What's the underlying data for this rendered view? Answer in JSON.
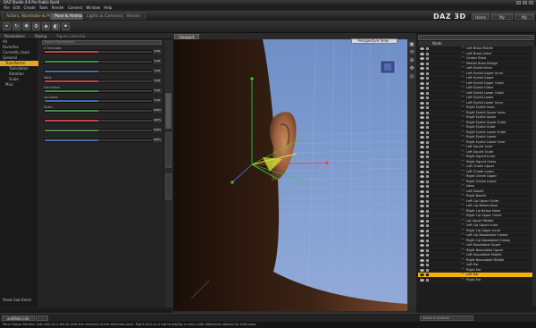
{
  "window": {
    "title": "DAZ Studio 4.6 Pro Public Build"
  },
  "menu": [
    "File",
    "Edit",
    "Create",
    "Tools",
    "Render",
    "Connect",
    "Window",
    "Help"
  ],
  "tabs": [
    "Actors, Wardrobe & Props",
    "Pose & Animate",
    "Lights & Cameras",
    "Render"
  ],
  "active_tab_index": 1,
  "brand": {
    "logo": "DAZ 3D"
  },
  "header_buttons": [
    "Home",
    "My Account",
    "My Gallery"
  ],
  "toolbar_icons": [
    "pointer-icon",
    "rotate-icon",
    "universal-tool-icon",
    "joint-editor-icon",
    "node-weight-icon",
    "surface-icon",
    "render-icon"
  ],
  "left_panel": {
    "tabs": [
      "Parameters",
      "Posing"
    ],
    "filter_label": "Figure: Lone Ear",
    "categories": [
      {
        "label": "All",
        "level": 0,
        "selected": false
      },
      {
        "label": "Favorites",
        "level": 0,
        "selected": false
      },
      {
        "label": "Currently Used",
        "level": 0,
        "selected": false
      },
      {
        "label": "General",
        "level": 0,
        "selected": false
      },
      {
        "label": "Transforms",
        "level": 1,
        "selected": true
      },
      {
        "label": "Translation",
        "level": 2,
        "selected": false
      },
      {
        "label": "Rotation",
        "level": 2,
        "selected": false
      },
      {
        "label": "Scale",
        "level": 2,
        "selected": false
      },
      {
        "label": "Misc",
        "level": 1,
        "selected": false
      }
    ],
    "show_sub_items": "Show Sub Items",
    "search_placeholder": "Search Parameters",
    "params": [
      {
        "label": "X Translate",
        "value": "0.00",
        "color": "#c04848",
        "fill": 0.5
      },
      {
        "label": "",
        "value": "0.00",
        "color": "#4a8a4a",
        "fill": 0.5
      },
      {
        "label": "",
        "value": "0.00",
        "color": "#4a6ab0",
        "fill": 0.5
      },
      {
        "label": "Twist",
        "value": "0.00",
        "color": "#c04848",
        "fill": 0.5
      },
      {
        "label": "Front-Back",
        "value": "0.00",
        "color": "#4a8a4a",
        "fill": 0.5
      },
      {
        "label": "Up-Down",
        "value": "0.00",
        "color": "#4a6ab0",
        "fill": 0.5
      },
      {
        "label": "Scale",
        "value": "100%",
        "color": "#4a8a4a",
        "fill": 0.5
      },
      {
        "label": "",
        "value": "100%",
        "color": "#c04848",
        "fill": 0.5
      },
      {
        "label": "",
        "value": "100%",
        "color": "#4a8a4a",
        "fill": 0.5
      },
      {
        "label": "",
        "value": "100%",
        "color": "#4a6ab0",
        "fill": 0.5
      }
    ]
  },
  "viewport": {
    "tab": "Viewport",
    "camera": "Perspective View",
    "icons": [
      "camera-icon",
      "rotate-view-icon",
      "zoom-icon",
      "pan-icon",
      "frame-icon"
    ]
  },
  "scene_panel": {
    "header": "Node",
    "nodes": [
      "Left Brow Middle",
      "Left Brow Outer",
      "Center Brow",
      "Middle Brow Bridge",
      "Left Eyelid Inner",
      "Left Eyelid Upper Inner",
      "Left Eyelid Upper",
      "Left Eyelid Upper Outer",
      "Left Eyelid Outer",
      "Left Eyelid Lower Outer",
      "Left Eyelid Lower",
      "Left Eyelid Lower Inner",
      "Right Eyelid Inner",
      "Right Eyelid Upper Inner",
      "Right Eyelid Upper",
      "Right Eyelid Upper Outer",
      "Right Eyelid Outer",
      "Right Eyelid Lower Outer",
      "Right Eyelid Lower",
      "Right Eyelid Lower Inner",
      "Left Squint Inner",
      "Left Squint Outer",
      "Right Squint Inner",
      "Right Squint Outer",
      "Left Cheek Upper",
      "Left Cheek Lower",
      "Right Cheek Upper",
      "Right Cheek Lower",
      "Nose",
      "Left Nostril",
      "Right Nostril",
      "Left Lip Upper Outer",
      "Left Lip Below Nose",
      "Right Lip Below Nose",
      "Right Lip Upper Outer",
      "Lip Upper Middle",
      "Left Lip Upper Inner",
      "Right Lip Upper Inner",
      "Left Lip Nasolabial Crease",
      "Right Lip Nasolabial Crease",
      "Left Nasolabial Upper",
      "Right Nasolabial Upper",
      "Left Nasolabial Middle",
      "Right Nasolabial Middle",
      "Left Ear",
      "Right Ear",
      "Left Ear",
      "Right Ear"
    ],
    "selected_index": 46,
    "selection_locator": "Select a Location"
  },
  "bottom": {
    "anim_tab": "aniMate Lite"
  },
  "status": "Pane Group Tab Bar: Left click on a tab to view the contents of the attached pane. Right click on a tab to display a menu with additional options for that pane."
}
